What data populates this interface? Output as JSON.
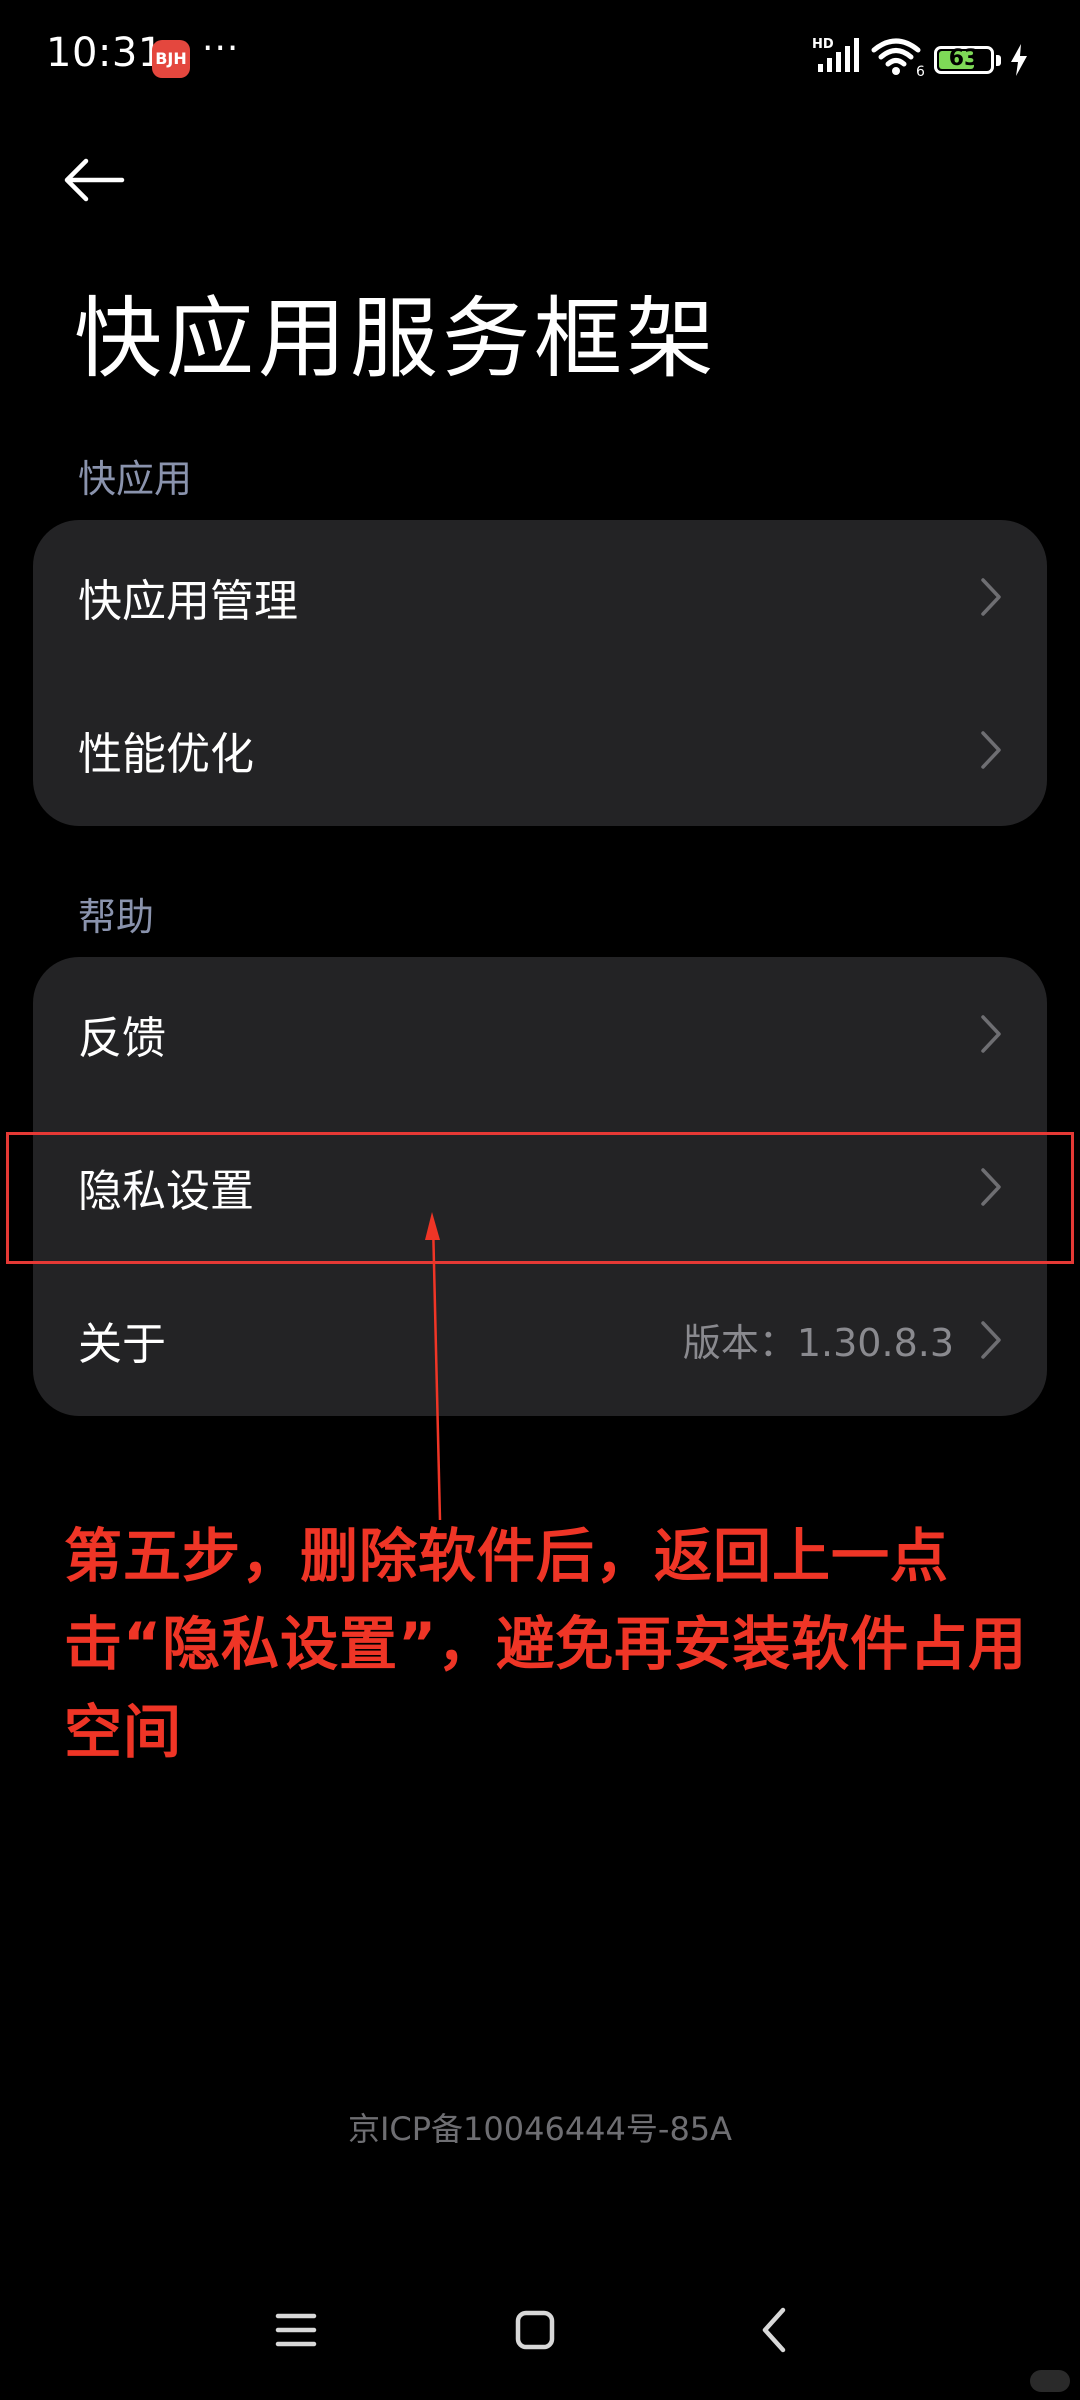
{
  "status_bar": {
    "time": "10:31",
    "app_icon_text": "BJH",
    "more": "···",
    "network_label": "HD",
    "wifi_label": "6",
    "battery": "63"
  },
  "header": {
    "title": "快应用服务框架"
  },
  "sections": [
    {
      "header": "快应用",
      "items": [
        {
          "label": "快应用管理",
          "value": ""
        },
        {
          "label": "性能优化",
          "value": ""
        }
      ]
    },
    {
      "header": "帮助",
      "items": [
        {
          "label": "反馈",
          "value": ""
        },
        {
          "label": "隐私设置",
          "value": ""
        },
        {
          "label": "关于",
          "value": "版本：1.30.8.3"
        }
      ]
    }
  ],
  "annotation": {
    "text": "第五步，删除软件后，返回上一点击“隐私设置”，避免再安装软件占用空间",
    "color": "#ef3526"
  },
  "footer": {
    "icp": "京ICP备10046444号-85A"
  },
  "navigation": {
    "icons": [
      "menu-icon",
      "home-icon",
      "back-icon"
    ]
  },
  "colors": {
    "background": "#000000",
    "card": "#232325",
    "section_header": "#8a93ad",
    "secondary_text": "#8a8a8f",
    "annotation_red": "#e53935"
  }
}
